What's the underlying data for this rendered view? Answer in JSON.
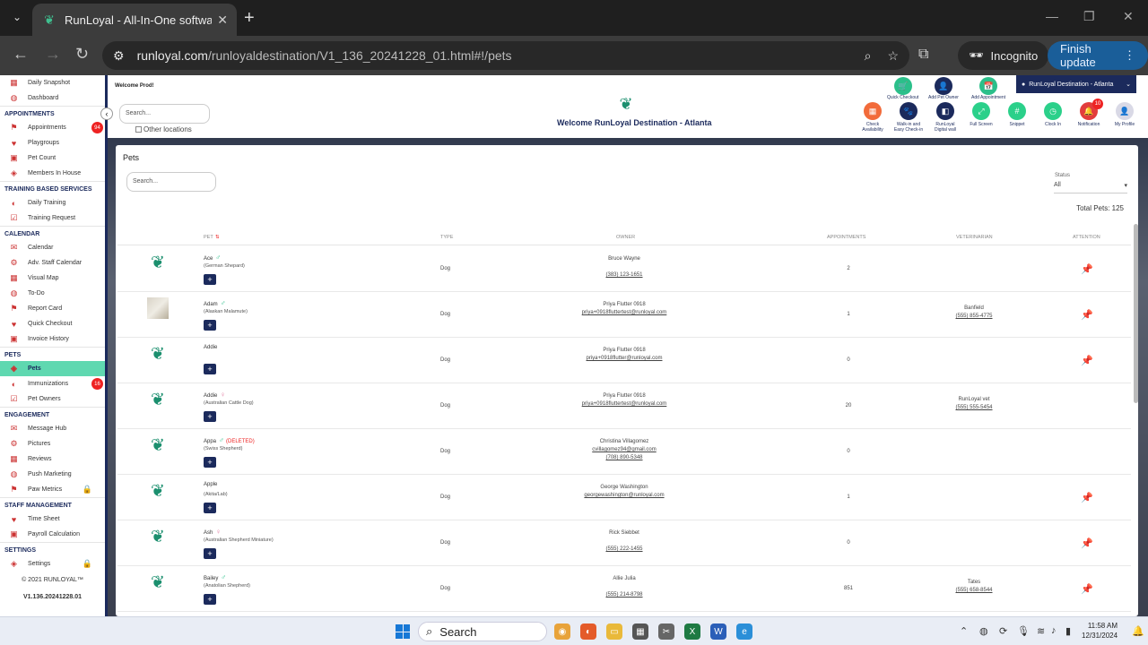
{
  "browser": {
    "tab_title": "RunLoyal - All-In-One software",
    "url_scheme": "runloyal.com",
    "url_path": "/runloyaldestination/V1_136_20241228_01.html#!/pets",
    "incognito_label": "Incognito",
    "finish_update_label": "Finish update"
  },
  "sidebar": {
    "top_items": [
      {
        "label": "Daily Snapshot"
      },
      {
        "label": "Dashboard"
      }
    ],
    "sections": [
      {
        "title": "APPOINTMENTS",
        "items": [
          {
            "label": "Appointments",
            "badge": "94"
          },
          {
            "label": "Playgroups"
          },
          {
            "label": "Pet Count"
          },
          {
            "label": "Members In House"
          }
        ]
      },
      {
        "title": "TRAINING BASED SERVICES",
        "items": [
          {
            "label": "Daily Training"
          },
          {
            "label": "Training Request"
          }
        ]
      },
      {
        "title": "CALENDAR",
        "items": [
          {
            "label": "Calendar"
          },
          {
            "label": "Adv. Staff Calendar"
          },
          {
            "label": "Visual Map"
          },
          {
            "label": "To-Do"
          },
          {
            "label": "Report Card"
          },
          {
            "label": "Quick Checkout"
          },
          {
            "label": "Invoice History"
          }
        ]
      },
      {
        "title": "PETS",
        "items": [
          {
            "label": "Pets",
            "active": true
          },
          {
            "label": "Immunizations",
            "badge": "16"
          },
          {
            "label": "Pet Owners"
          }
        ]
      },
      {
        "title": "ENGAGEMENT",
        "items": [
          {
            "label": "Message Hub"
          },
          {
            "label": "Pictures"
          },
          {
            "label": "Reviews"
          },
          {
            "label": "Push Marketing"
          },
          {
            "label": "Paw Metrics",
            "locked": true
          }
        ]
      },
      {
        "title": "STAFF MANAGEMENT",
        "items": [
          {
            "label": "Time Sheet"
          },
          {
            "label": "Payroll Calculation"
          }
        ]
      },
      {
        "title": "SETTINGS",
        "items": [
          {
            "label": "Settings",
            "locked": true
          }
        ]
      }
    ],
    "copyright": "© 2021  RUNLOYAL™",
    "version": "V1.136.20241228.01"
  },
  "header": {
    "welcome_prod": "Welcome Prod!",
    "search_placeholder": "Search...",
    "other_locations": "Other locations",
    "welcome_title": "Welcome RunLoyal Destination - Atlanta",
    "location_selector": "RunLoyal Destination - Atlanta",
    "quick_actions": [
      {
        "label": "Quick Checkout",
        "color": "#2bbf8a"
      },
      {
        "label": "Add Pet Owner",
        "color": "#1b2a5c"
      },
      {
        "label": "Add Appointment",
        "color": "#2bbf8a"
      }
    ],
    "buttons": [
      {
        "label": "Check Availability",
        "color": "#f26b3a"
      },
      {
        "label": "Walk-in and Easy Check-in",
        "color": "#1b2a5c"
      },
      {
        "label": "RunLoyal Digital wall",
        "color": "#1b2a5c"
      },
      {
        "label": "Full Screen",
        "color": "#2bd08a"
      },
      {
        "label": "Snippet",
        "color": "#2bd08a"
      },
      {
        "label": "Clock In",
        "color": "#2bd08a"
      },
      {
        "label": "Notification",
        "color": "#e23c3c",
        "badge": "10"
      },
      {
        "label": "My Profile",
        "color": "#d9d9e6"
      }
    ]
  },
  "pets_card": {
    "title": "Pets",
    "search_placeholder": "Search...",
    "status_label": "Status",
    "status_value": "All",
    "total": "Total Pets: 125",
    "columns": [
      "PET",
      "TYPE",
      "OWNER",
      "APPOINTMENTS",
      "VETERINARIAN",
      "ATTENTION"
    ],
    "rows": [
      {
        "name": "Ace",
        "sex": "♂",
        "deleted": "",
        "breed": "(German Shepard)",
        "type": "Dog",
        "owner": "Bruce Wayne",
        "owner_email": "",
        "owner_phone": "(383) 123-1651",
        "appointments": "2",
        "vet": "",
        "vet_phone": "",
        "attention": true,
        "photo": false
      },
      {
        "name": "Adam",
        "sex": "♂",
        "deleted": "",
        "breed": "(Alaskan Malamute)",
        "type": "Dog",
        "owner": "Priya Flutter 0918",
        "owner_email": "priya+0918fluttertest@runloyal.com",
        "owner_phone": "",
        "appointments": "1",
        "vet": "Banfield",
        "vet_phone": "(555) 855-4775",
        "attention": true,
        "photo": true
      },
      {
        "name": "Addie",
        "sex": "",
        "deleted": "",
        "breed": "",
        "type": "Dog",
        "owner": "Priya Flutter 0918",
        "owner_email": "priya+0918flutter@runloyal.com",
        "owner_phone": "",
        "appointments": "0",
        "vet": "",
        "vet_phone": "",
        "attention": true,
        "photo": false
      },
      {
        "name": "Addie",
        "sex": "♀",
        "deleted": "",
        "breed": "(Australian Cattle Dog)",
        "type": "Dog",
        "owner": "Priya Flutter 0918",
        "owner_email": "priya+0918fluttertest@runloyal.com",
        "owner_phone": "",
        "appointments": "20",
        "vet": "RunLoyal vet",
        "vet_phone": "(555) 555-5454",
        "attention": false,
        "photo": false
      },
      {
        "name": "Appa",
        "sex": "♂",
        "deleted": "(DELETED)",
        "breed": "(Swiss Shepherd)",
        "type": "Dog",
        "owner": "Christina Villagomez",
        "owner_email": "cvillagomez94@gmail.com",
        "owner_phone": "(708) 890-5348",
        "appointments": "0",
        "vet": "",
        "vet_phone": "",
        "attention": false,
        "photo": false
      },
      {
        "name": "Apple",
        "sex": "",
        "deleted": "",
        "breed": "(Akita/Lab)",
        "type": "Dog",
        "owner": "George Washington",
        "owner_email": "georgewashington@runloyal.com",
        "owner_phone": "",
        "appointments": "1",
        "vet": "",
        "vet_phone": "",
        "attention": true,
        "photo": false
      },
      {
        "name": "Ash",
        "sex": "♀",
        "deleted": "",
        "breed": "(Australian Shepherd Miniature)",
        "type": "Dog",
        "owner": "Rick Siebbet",
        "owner_email": "",
        "owner_phone": "(555) 222-1455",
        "appointments": "0",
        "vet": "",
        "vet_phone": "",
        "attention": true,
        "photo": false
      },
      {
        "name": "Bailey",
        "sex": "♂",
        "deleted": "",
        "breed": "(Anatolian Shepherd)",
        "type": "Dog",
        "owner": "Allie Julia",
        "owner_email": "",
        "owner_phone": "(555) 214-8798",
        "appointments": "851",
        "vet": "Tates",
        "vet_phone": "(555) 658-8544",
        "attention": true,
        "photo": false
      }
    ]
  },
  "taskbar": {
    "search_label": "Search",
    "time": "11:58 AM",
    "date": "12/31/2024"
  }
}
